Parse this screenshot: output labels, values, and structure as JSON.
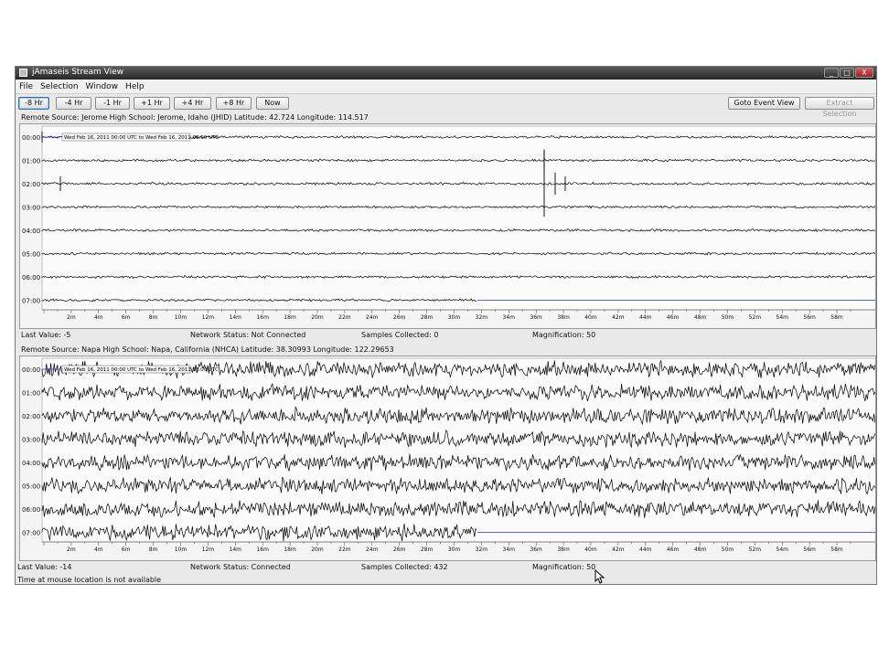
{
  "window": {
    "title": "jAmaseis Stream View",
    "controls": [
      "_",
      "□",
      "X"
    ]
  },
  "menu": [
    "File",
    "Selection",
    "Window",
    "Help"
  ],
  "toolbar": {
    "buttons": [
      "-8 Hr",
      "-4 Hr",
      "-1 Hr",
      "+1 Hr",
      "+4 Hr",
      "+8 Hr",
      "Now"
    ],
    "goto_event": "Goto Event View",
    "extract_selection": "Extract Selection"
  },
  "stream1": {
    "source": "Remote Source: Jerome High School: Jerome, Idaho (JHID) Latitude: 42.724 Longitude: 114.517",
    "time_range": "Wed Feb 16, 2011 00:00 UTC to Wed Feb 16, 2011 08:00 UTC",
    "hour_labels": [
      "00:00",
      "01:00",
      "02:00",
      "03:00",
      "04:00",
      "05:00",
      "06:00",
      "07:00"
    ],
    "last_value": "Last Value:  -5",
    "network_status": "Network Status:  Not Connected",
    "samples": "Samples Collected:  0",
    "magnification": "Magnification:  50",
    "trace_color": "#000000",
    "baseline_color": "#2b2bd8"
  },
  "stream2": {
    "source": "Remote Source: Napa High School: Napa, California (NHCA) Latitude: 38.30993 Longitude: 122.29653",
    "time_range": "Wed Feb 16, 2011 00:00 UTC to Wed Feb 16, 2011 08:00 UTC",
    "hour_labels": [
      "00:00",
      "01:00",
      "02:00",
      "03:00",
      "04:00",
      "05:00",
      "06:00",
      "07:00"
    ],
    "last_value": "Last Value:  -14",
    "network_status": "Network Status:  Connected",
    "samples": "Samples Collected:  432",
    "magnification": "Magnification:  50",
    "trace_color": "#000000",
    "baseline_color": "#2b2bd8"
  },
  "minute_ticks": [
    "2m",
    "4m",
    "6m",
    "8m",
    "10m",
    "12m",
    "14m",
    "16m",
    "18m",
    "20m",
    "22m",
    "24m",
    "26m",
    "28m",
    "30m",
    "32m",
    "34m",
    "36m",
    "38m",
    "40m",
    "42m",
    "44m",
    "46m",
    "48m",
    "50m",
    "52m",
    "54m",
    "56m",
    "58m"
  ],
  "status_bar": "Time at mouse location is not available"
}
